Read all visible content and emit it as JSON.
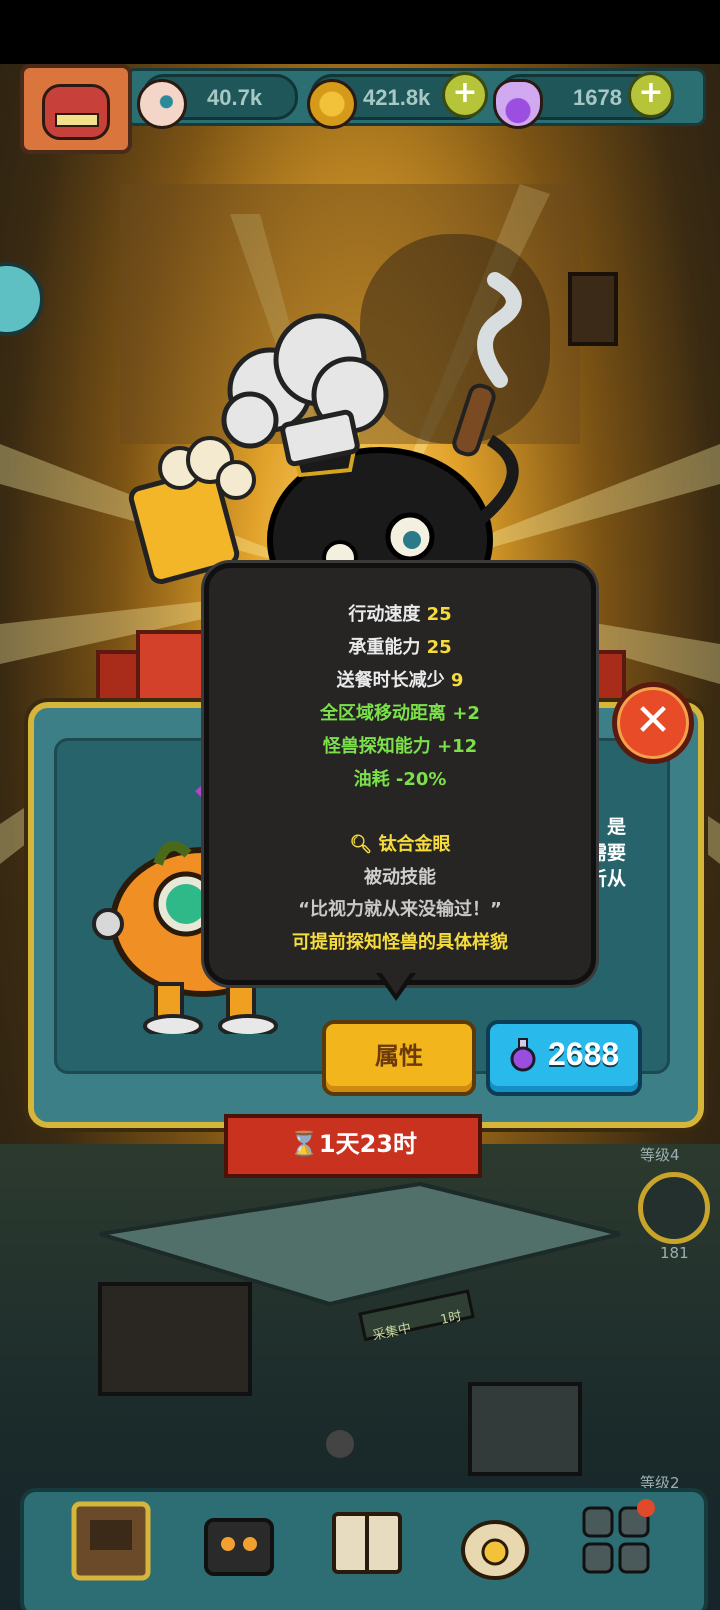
{
  "resources": {
    "eyes": "40.7k",
    "coins": "421.8k",
    "potions": "1678"
  },
  "tooltip": {
    "stats": [
      {
        "label": "行动速度",
        "value": "25"
      },
      {
        "label": "承重能力",
        "value": "25"
      },
      {
        "label": "送餐时长减少",
        "value": "9"
      }
    ],
    "bonuses": [
      {
        "label": "全区域移动距离",
        "value": "+2"
      },
      {
        "label": "怪兽探知能力",
        "value": "+12"
      },
      {
        "label": "油耗",
        "value": "-20%"
      }
    ],
    "skill_name": "钛合金眼",
    "skill_type": "被动技能",
    "skill_quote": "“比视力就从来没输过！”",
    "skill_effect": "可提前探知怪兽的具体样貌"
  },
  "panel": {
    "desc_fragments": [
      "，是",
      "需要",
      "听从"
    ],
    "attribute_button": "属性",
    "price": "2688",
    "timer": "1天23时"
  },
  "side": {
    "level_1": "等级4",
    "level_1_count": "181",
    "level_2": "等级2"
  },
  "room": {
    "collect_sign": "采集中",
    "collect_time": "1时"
  },
  "colors": {
    "accent_yellow": "#f2b51b",
    "accent_blue": "#29b9ea",
    "bonus_green": "#7be04a",
    "close_red": "#e84b27"
  }
}
